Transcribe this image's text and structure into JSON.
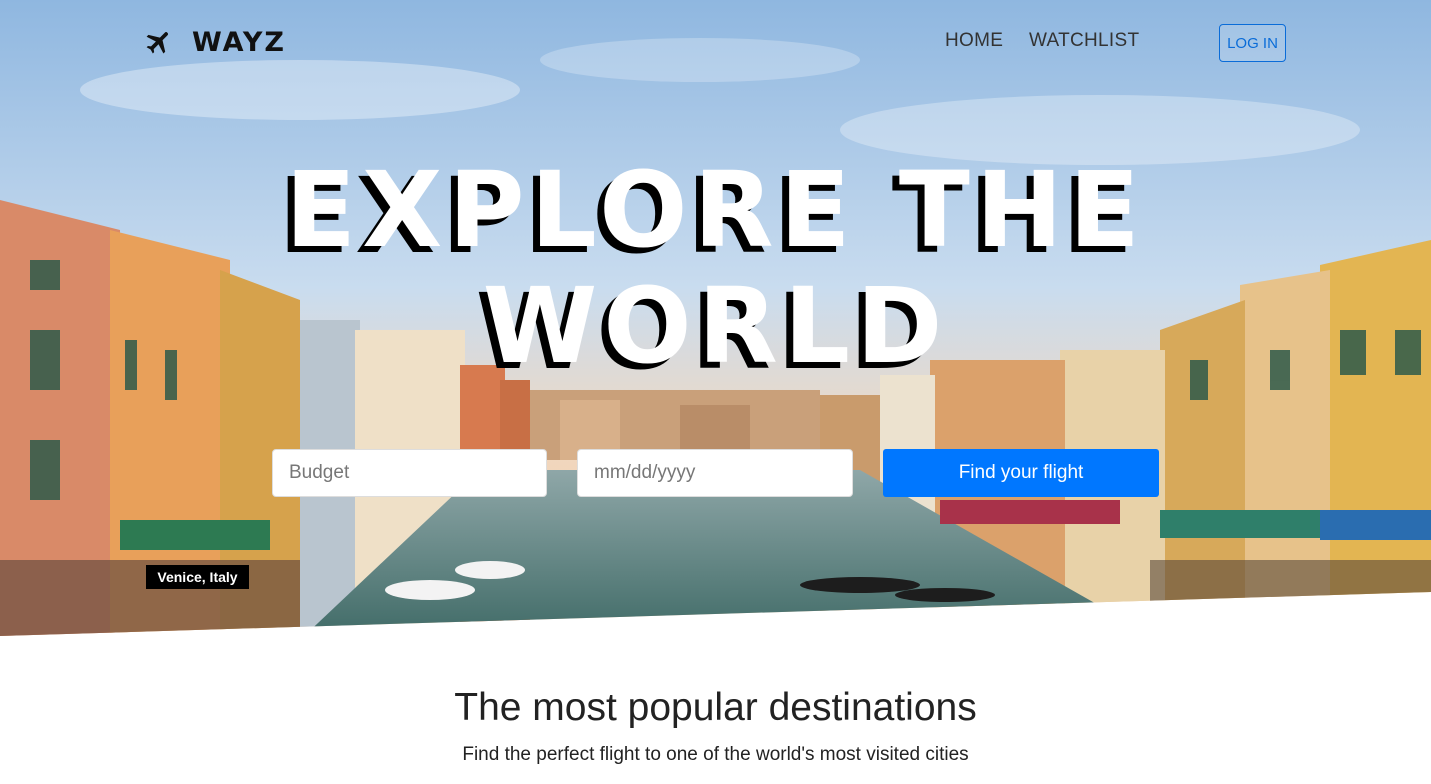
{
  "nav": {
    "brand": "WAYZ",
    "logo_icon": "airplane-icon",
    "links": [
      "HOME",
      "WATCHLIST"
    ],
    "login_label": "LOG IN"
  },
  "hero": {
    "headline_line1": "EXPLORE THE",
    "headline_line2": "WORLD",
    "budget_placeholder": "Budget",
    "date_placeholder": "mm/dd/yyyy",
    "search_button": "Find your flight",
    "location_caption": "Venice, Italy"
  },
  "popular": {
    "title": "The most popular destinations",
    "subtitle": "Find the perfect flight to one of the world's most visited cities"
  },
  "colors": {
    "accent": "#0077ff",
    "login_border": "#0a6cd8",
    "headline_shadow": "#000000"
  }
}
